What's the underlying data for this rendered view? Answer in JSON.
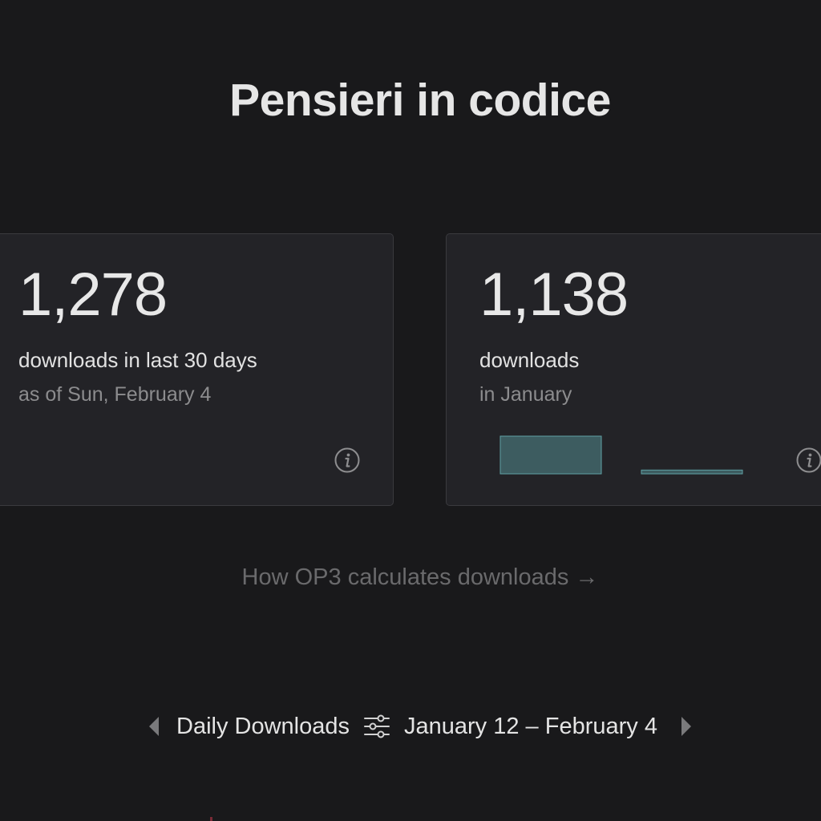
{
  "page": {
    "title": "Pensieri in codice"
  },
  "cards": [
    {
      "number": "1,278",
      "label": "downloads in last 30 days",
      "sublabel": "as of Sun, February 4",
      "info_icon": "info-icon"
    },
    {
      "number": "1,138",
      "label": "downloads",
      "sublabel": "in January",
      "info_icon": "info-icon",
      "mini_bars": [
        {
          "value": 1.0
        },
        {
          "value": 0.1
        }
      ]
    }
  ],
  "link": {
    "text": "How OP3 calculates downloads →"
  },
  "chart_nav": {
    "title": "Daily Downloads",
    "range": "January 12 – February 4",
    "prev_icon": "caret-left-icon",
    "next_icon": "caret-right-icon",
    "filter_icon": "sliders-icon"
  },
  "colors": {
    "background": "#19191b",
    "card": "#232327",
    "bar_fill": "#3d5c60",
    "bar_stroke": "#5fa0a4"
  }
}
